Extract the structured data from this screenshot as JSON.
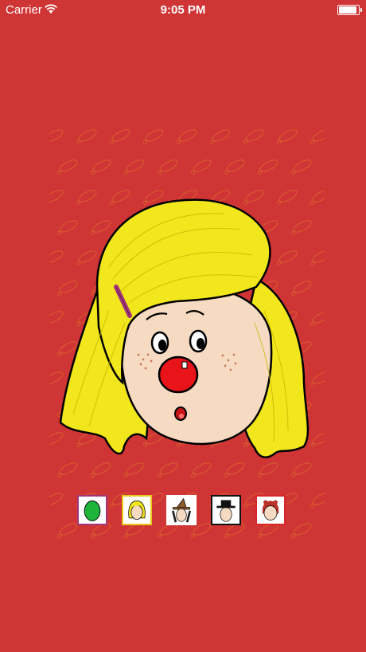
{
  "status_bar": {
    "carrier": "Carrier",
    "time": "9:05 PM",
    "battery_level": 1.0,
    "wifi_icon": "wifi-icon",
    "battery_icon": "battery-icon"
  },
  "background_color": "#cf3535",
  "character": {
    "hair_color": "#f2e61c",
    "skin_color": "#f6dbc2",
    "nose_color": "#e8141a",
    "clip_color": "#a3357b"
  },
  "thumbnails": [
    {
      "name": "green-face-thumbnail",
      "border_color": "#a3357b",
      "selected": false
    },
    {
      "name": "blonde-girl-thumbnail",
      "border_color": "#e8c91a",
      "selected": true
    },
    {
      "name": "witch-thumbnail",
      "border_color": "#ffffff",
      "selected": false
    },
    {
      "name": "black-hat-thumbnail",
      "border_color": "#111111",
      "selected": false
    },
    {
      "name": "red-hair-girl-thumbnail",
      "border_color": "#d9262a",
      "selected": false
    }
  ]
}
